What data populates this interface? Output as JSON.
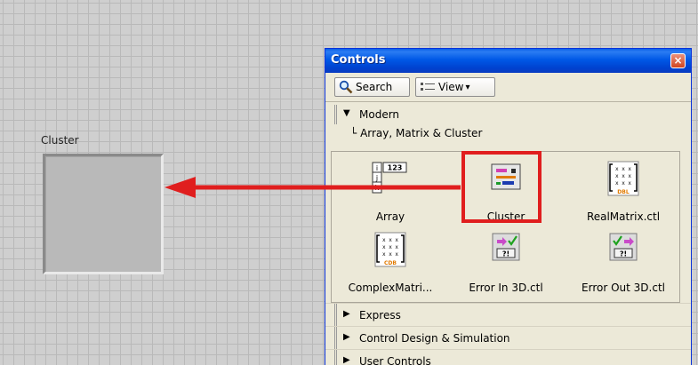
{
  "front_panel": {
    "cluster_label": "Cluster"
  },
  "palette": {
    "title": "Controls",
    "close_glyph": "×",
    "toolbar": {
      "search_label": "Search",
      "view_label": "View",
      "view_arrow": "▾"
    },
    "tree": {
      "expanded_arrow": "▼",
      "collapsed_arrow": "▶",
      "top_category": "Modern",
      "sub_prefix": "└",
      "subcategory": "Array, Matrix & Cluster",
      "items": [
        {
          "label": "Array",
          "icon": "array-icon"
        },
        {
          "label": "Cluster",
          "icon": "cluster-icon"
        },
        {
          "label": "RealMatrix.ctl",
          "icon": "real-matrix-icon",
          "tag": "DBL"
        },
        {
          "label": "ComplexMatri...",
          "icon": "complex-matrix-icon",
          "tag": "CDB"
        },
        {
          "label": "Error In 3D.ctl",
          "icon": "error-in-icon",
          "tag": "?!"
        },
        {
          "label": "Error Out 3D.ctl",
          "icon": "error-out-icon",
          "tag": "?!"
        }
      ],
      "collapsed_categories": [
        "Express",
        "Control Design & Simulation",
        "User Controls"
      ]
    },
    "array_icon_text": {
      "index": [
        "i",
        "j",
        "k"
      ],
      "value": "123"
    },
    "matrix_glyph": "x x x"
  },
  "colors": {
    "highlight": "#e01e1e",
    "titlebar": "#0058e6"
  }
}
